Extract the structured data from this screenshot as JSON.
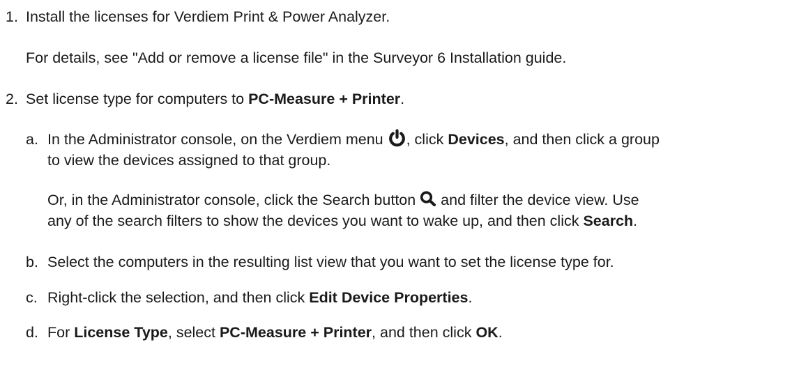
{
  "steps": [
    {
      "number": "1.",
      "text": "Install the licenses for Verdiem Print & Power Analyzer.",
      "note": "For details, see \"Add or remove a license file\" in the Surveyor 6 Installation guide."
    },
    {
      "number": "2.",
      "text_before": "Set license type for computers to ",
      "text_bold": "PC-Measure + Printer",
      "text_after": ".",
      "substeps": {
        "a": {
          "letter": "a.",
          "line1_pre": "In the Administrator console, on the Verdiem menu ",
          "line1_mid": ", click ",
          "line1_bold": "Devices",
          "line1_post": ", and then click a group",
          "line2": "to view the devices assigned to that group.",
          "alt1_pre": "Or, in the Administrator console, click the Search button ",
          "alt1_post": " and filter the device view. Use",
          "alt2_pre": "any of the search filters to show the devices you want to wake up, and then click ",
          "alt2_bold": "Search",
          "alt2_post": "."
        },
        "b": {
          "letter": "b.",
          "text": "Select the computers in the resulting list view that you want to set the license type for."
        },
        "c": {
          "letter": "c.",
          "text_pre": "Right-click the selection, and then click ",
          "text_bold": "Edit Device Properties",
          "text_post": "."
        },
        "d": {
          "letter": "d.",
          "text_pre": "For ",
          "bold1": "License Type",
          "text_mid1": ", select ",
          "bold2": "PC-Measure + Printer",
          "text_mid2": ", and then click ",
          "bold3": "OK",
          "text_post": "."
        }
      }
    }
  ],
  "icons": {
    "power": "power-icon",
    "search": "search-icon"
  }
}
